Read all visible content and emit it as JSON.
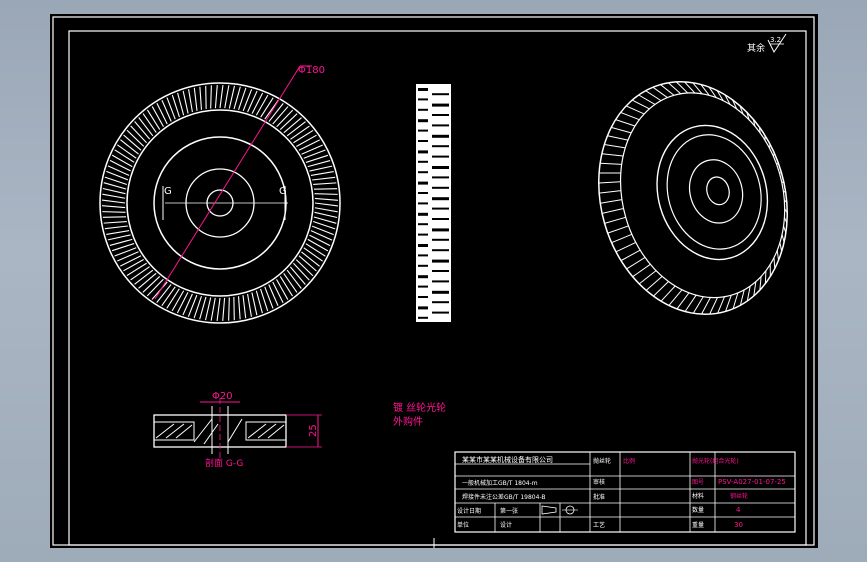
{
  "drawing": {
    "roughness_symbol": "其余",
    "roughness_value": "3.2",
    "dim_diameter_outer": "Φ180",
    "dim_diameter_hub": "Φ20",
    "dim_height": "25",
    "section_mark_left": "G",
    "section_mark_right": "G",
    "section_label": "剖面 G-G",
    "note_line1": "镀 丝轮光轮",
    "note_line2": "外购件",
    "colors": {
      "background": "#000000",
      "lines": "#ffffff",
      "dimensions": "#ff1493",
      "frame_bg": "#9aa7b6"
    }
  },
  "title_block": {
    "company_line1": "某某市某某机械设备有限公司",
    "company_line2": "一般机械加工GB/T 1804-m",
    "company_line3": "焊接件未注公差GB/T 19804-B",
    "label_design": "设计日期",
    "label_check": "审核",
    "label_approve": "批准",
    "label_craft": "工艺",
    "label_scale_row": "比例",
    "label_sheet": "第一张",
    "label_unit": "单位",
    "label_person": "设计",
    "part_name_label": "抛丝轮",
    "part_name_value": "抛光轮(组合光轮)",
    "drawing_no_label": "图号",
    "drawing_no_value": "PSV-A027-01-07-25",
    "material_label": "材料",
    "material_value": "钢丝轮",
    "quantity_label": "数量",
    "quantity_value": "4",
    "weight_label": "重量",
    "weight_value": "30"
  }
}
